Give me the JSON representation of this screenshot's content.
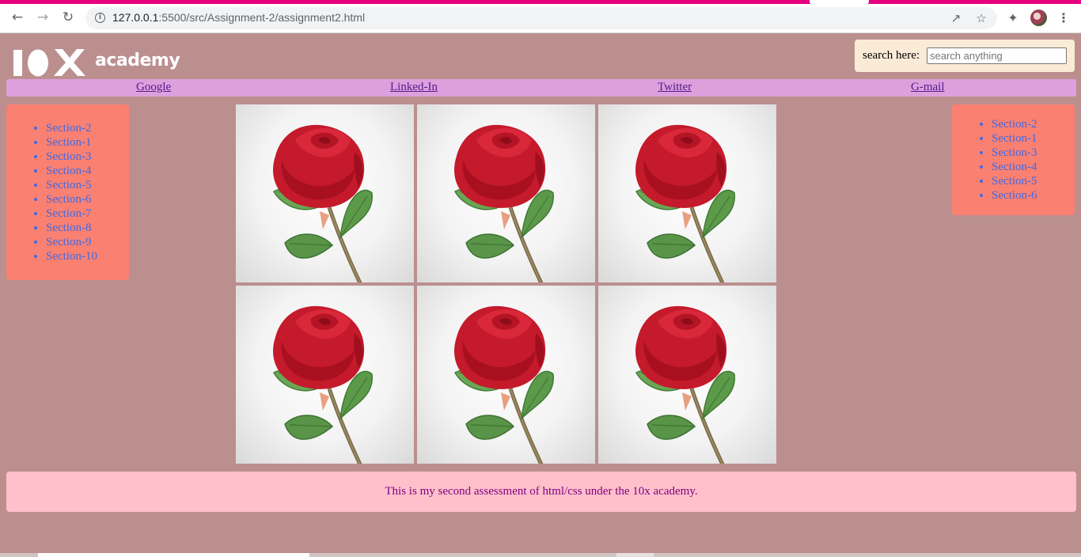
{
  "browser": {
    "url_host": "127.0.0.1",
    "url_path": ":5500/src/Assignment-2/assignment2.html",
    "icons": {
      "back": "back-arrow-icon",
      "forward": "forward-arrow-icon",
      "reload": "reload-icon",
      "site_info": "info-icon",
      "share": "share-icon",
      "bookmark": "star-icon",
      "extensions": "puzzle-icon",
      "profile": "avatar",
      "menu": "kebab-menu-icon"
    },
    "accent_color": "#e6007e"
  },
  "header": {
    "logo_text": "academy",
    "search_label": "search here:",
    "search_placeholder": "search anything",
    "search_value": ""
  },
  "nav": {
    "links": [
      "Google",
      "Linked-In",
      "Twitter",
      "G-mail"
    ]
  },
  "left_sections": [
    "Section-2",
    "Section-1",
    "Section-3",
    "Section-4",
    "Section-5",
    "Section-6",
    "Section-7",
    "Section-8",
    "Section-9",
    "Section-10"
  ],
  "right_sections": [
    "Section-2",
    "Section-1",
    "Section-3",
    "Section-4",
    "Section-5",
    "Section-6"
  ],
  "gallery": {
    "image_count": 6,
    "image_subject": "red rose"
  },
  "footer": {
    "text": "This is my second assessment of html/css under the 10x academy."
  },
  "colors": {
    "page_background": "#bc8f8f",
    "navbar": "#dda0dd",
    "side_panels": "#fa8072",
    "search_box": "#faebd7",
    "footer": "#ffc0cb",
    "footer_text": "#800080",
    "section_links": "#4169e1"
  }
}
